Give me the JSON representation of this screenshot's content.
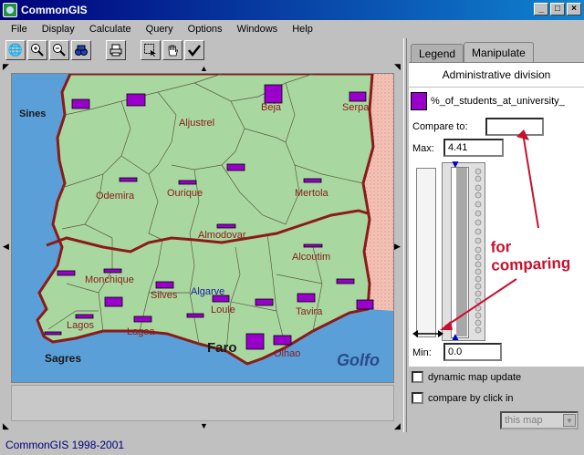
{
  "window": {
    "title": "CommonGIS"
  },
  "menu": [
    "File",
    "Display",
    "Calculate",
    "Query",
    "Options",
    "Windows",
    "Help"
  ],
  "toolbar": [
    "globe-icon",
    "zoom-in-icon",
    "zoom-out-icon",
    "binoculars-icon",
    "print-icon",
    "select-icon",
    "hand-icon",
    "check-icon"
  ],
  "map": {
    "places": [
      {
        "name": "Sines",
        "color": "#1a1a1a"
      },
      {
        "name": "Aljustrel",
        "color": "#8b1a1a"
      },
      {
        "name": "Beja",
        "color": "#8b1a1a"
      },
      {
        "name": "Serpa",
        "color": "#8b1a1a"
      },
      {
        "name": "Odemira",
        "color": "#8b1a1a"
      },
      {
        "name": "Ourique",
        "color": "#8b1a1a"
      },
      {
        "name": "Mertola",
        "color": "#8b1a1a"
      },
      {
        "name": "Almodovar",
        "color": "#8b1a1a"
      },
      {
        "name": "Alcoutim",
        "color": "#8b1a1a"
      },
      {
        "name": "Monchique",
        "color": "#8b1a1a"
      },
      {
        "name": "Silves",
        "color": "#8b1a1a"
      },
      {
        "name": "Algarve",
        "color": "#1a1aa0"
      },
      {
        "name": "Loule",
        "color": "#8b1a1a"
      },
      {
        "name": "Tavira",
        "color": "#8b1a1a"
      },
      {
        "name": "Lagos",
        "color": "#8b1a1a"
      },
      {
        "name": "Lagoa",
        "color": "#8b1a1a"
      },
      {
        "name": "Olhao",
        "color": "#8b1a1a"
      },
      {
        "name": "Faro",
        "color": "#1a1a1a"
      },
      {
        "name": "Sagres",
        "color": "#1a1a1a"
      },
      {
        "name": "Golfo",
        "color": "#2a4a8a"
      }
    ]
  },
  "panel": {
    "tabs": {
      "legend": "Legend",
      "manipulate": "Manipulate"
    },
    "header": "Administrative division",
    "attribute": "%_of_students_at_university_",
    "compare_label": "Compare to:",
    "compare_value": "",
    "max_label": "Max:",
    "max_value": "4.41",
    "min_label": "Min:",
    "min_value": "0.0",
    "dynamic_label": "dynamic map update",
    "click_label": "compare by click in",
    "click_select": "this map",
    "annotation": "for comparing"
  },
  "status": "CommonGIS 1998-2001",
  "colors": {
    "symbol": "#9900cc",
    "land": "#a8d8a0",
    "sea": "#5a9fd8",
    "border": "#8b1a1a"
  }
}
